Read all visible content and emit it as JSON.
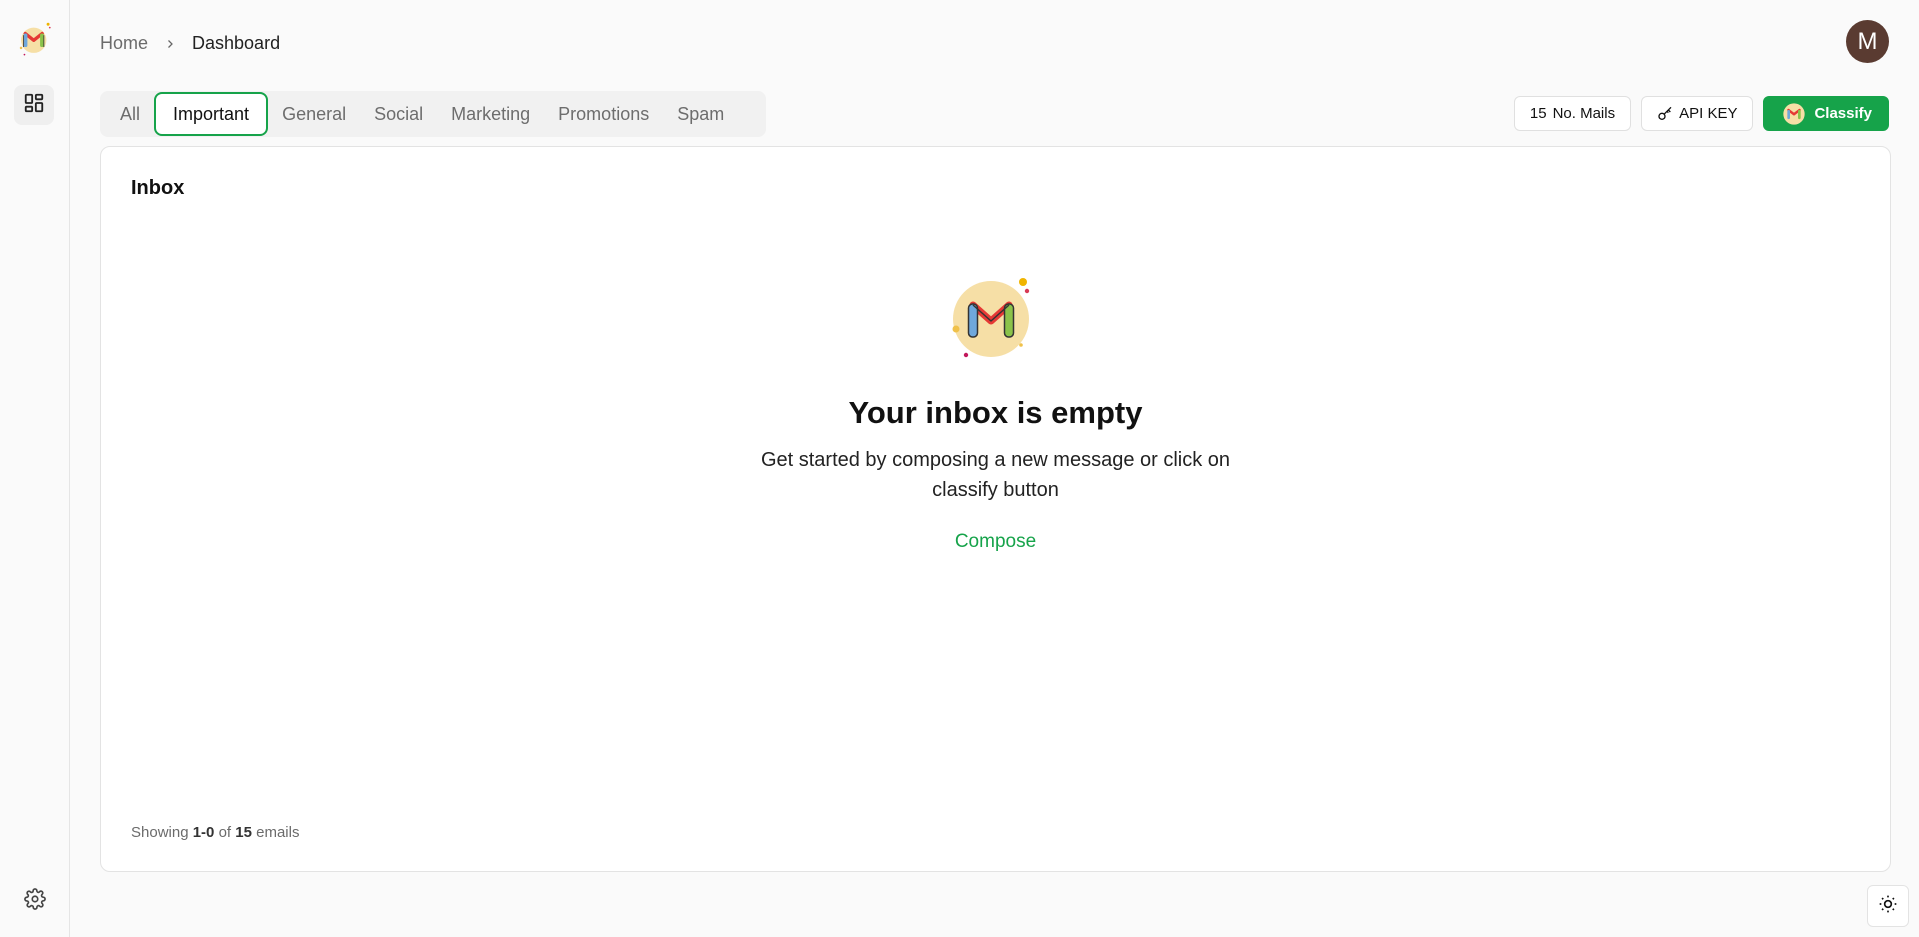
{
  "app": {
    "logo_icon": "gmail-logo-icon",
    "colors": {
      "accent": "#16a34a",
      "avatar_bg": "#5a3b31"
    }
  },
  "sidebar": {
    "items": [
      {
        "icon": "dashboard-icon"
      },
      {
        "icon": "gear-icon"
      }
    ]
  },
  "breadcrumb": {
    "home": "Home",
    "current": "Dashboard"
  },
  "user": {
    "avatar_initial": "M"
  },
  "tabs": [
    {
      "label": "All",
      "active": false
    },
    {
      "label": "Important",
      "active": true
    },
    {
      "label": "General",
      "active": false
    },
    {
      "label": "Social",
      "active": false
    },
    {
      "label": "Marketing",
      "active": false
    },
    {
      "label": "Promotions",
      "active": false
    },
    {
      "label": "Spam",
      "active": false
    }
  ],
  "actions": {
    "mails_count": "15",
    "mails_label": "No. Mails",
    "api_key_label": "API KEY",
    "classify_label": "Classify"
  },
  "inbox": {
    "title": "Inbox",
    "empty_title": "Your inbox is empty",
    "empty_desc": "Get started by composing a new message or click on classify button",
    "compose_label": "Compose",
    "footer": {
      "prefix": "Showing",
      "range": "1-0",
      "of": "of",
      "total": "15",
      "suffix": "emails"
    }
  },
  "theme": {
    "icon": "sun-icon"
  }
}
